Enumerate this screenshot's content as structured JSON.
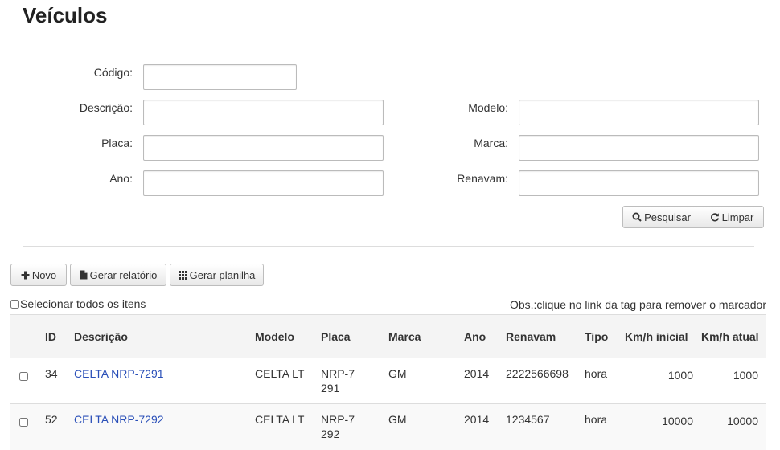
{
  "page": {
    "title": "Veículos"
  },
  "form": {
    "codigo_label": "Código:",
    "descricao_label": "Descrição:",
    "placa_label": "Placa:",
    "ano_label": "Ano:",
    "modelo_label": "Modelo:",
    "marca_label": "Marca:",
    "renavam_label": "Renavam:",
    "codigo_value": "",
    "descricao_value": "",
    "placa_value": "",
    "ano_value": "",
    "modelo_value": "",
    "marca_value": "",
    "renavam_value": "",
    "search_label": "Pesquisar",
    "clear_label": "Limpar"
  },
  "toolbar": {
    "new_label": "Novo",
    "report_label": "Gerar relatório",
    "spreadsheet_label": "Gerar planilha"
  },
  "list": {
    "select_all_label": "Selecionar todos os itens",
    "note": "Obs.:clique no link da tag para remover o marcador",
    "columns": {
      "id": "ID",
      "descricao": "Descrição",
      "modelo": "Modelo",
      "placa": "Placa",
      "marca": "Marca",
      "ano": "Ano",
      "renavam": "Renavam",
      "tipo": "Tipo",
      "km_inicial": "Km/h inicial",
      "km_atual": "Km/h atual"
    },
    "rows": [
      {
        "id": "34",
        "descricao": "CELTA NRP-7291",
        "modelo": "CELTA LT",
        "placa": "NRP-7291",
        "marca": "GM",
        "ano": "2014",
        "renavam": "2222566698",
        "tipo": "hora",
        "km_inicial": "1000",
        "km_atual": "1000"
      },
      {
        "id": "52",
        "descricao": "CELTA NRP-7292",
        "modelo": "CELTA LT",
        "placa": "NRP-7292",
        "marca": "GM",
        "ano": "2014",
        "renavam": "1234567",
        "tipo": "hora",
        "km_inicial": "10000",
        "km_atual": "10000"
      }
    ]
  },
  "icons": {
    "search": "search-icon",
    "refresh": "refresh-icon",
    "plus": "plus-icon",
    "file": "file-icon",
    "grid": "grid-icon"
  },
  "colors": {
    "link": "#2a4fb8",
    "header_bg": "#f4f4f4",
    "border": "#dddddd"
  }
}
